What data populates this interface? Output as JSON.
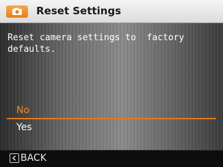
{
  "title": "Reset Settings",
  "title_icon": "camera-settings-icon",
  "message": "Reset camera settings to  factory\ndefaults.",
  "options": [
    {
      "label": "No",
      "selected": true
    },
    {
      "label": "Yes",
      "selected": false
    }
  ],
  "footer": {
    "back_icon": "chevron-left-icon",
    "back_label": "BACK"
  },
  "colors": {
    "accent": "#e8781a",
    "title_bar": "#e6e6e6",
    "text": "#ffffff"
  }
}
